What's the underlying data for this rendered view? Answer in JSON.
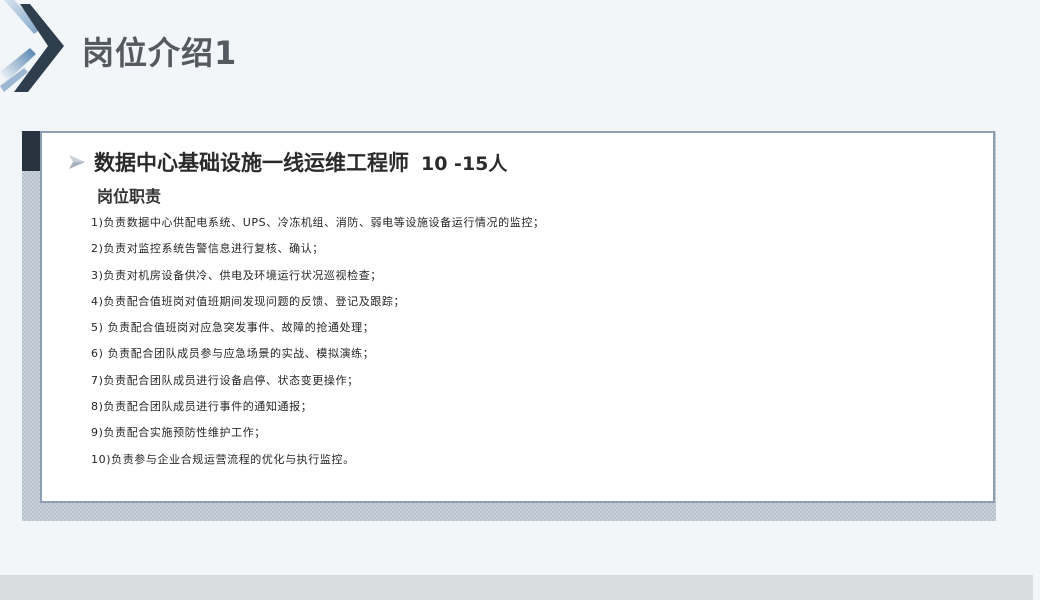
{
  "page": {
    "title": "岗位介绍1"
  },
  "job": {
    "title": "数据中心基础设施一线运维工程师",
    "headcount": "10 -15人"
  },
  "responsibilities": {
    "heading": "岗位职责",
    "items": [
      "1)负责数据中心供配电系统、UPS、冷冻机组、消防、弱电等设施设备运行情况的监控；",
      "2)负责对监控系统告警信息进行复核、确认；",
      "3)负责对机房设备供冷、供电及环境运行状况巡视检查；",
      "4)负责配合值班岗对值班期间发现问题的反馈、登记及跟踪；",
      "5)   负责配合值班岗对应急突发事件、故障的抢通处理；",
      "6)   负责配合团队成员参与应急场景的实战、模拟演练；",
      "7)负责配合团队成员进行设备启停、状态变更操作；",
      "8)负责配合团队成员进行事件的通知通报；",
      "9)负责配合实施预防性维护工作；",
      "10)负责参与企业合规运营流程的优化与执行监控。"
    ]
  },
  "colors": {
    "title_text": "#555a60",
    "card_border": "#8da0b3",
    "accent_dark": "#26323d",
    "accent_blue": "#3a6ea5"
  },
  "icons": {
    "corner": "chevron-logo-icon",
    "bullet": "arrow-bullet-icon"
  }
}
